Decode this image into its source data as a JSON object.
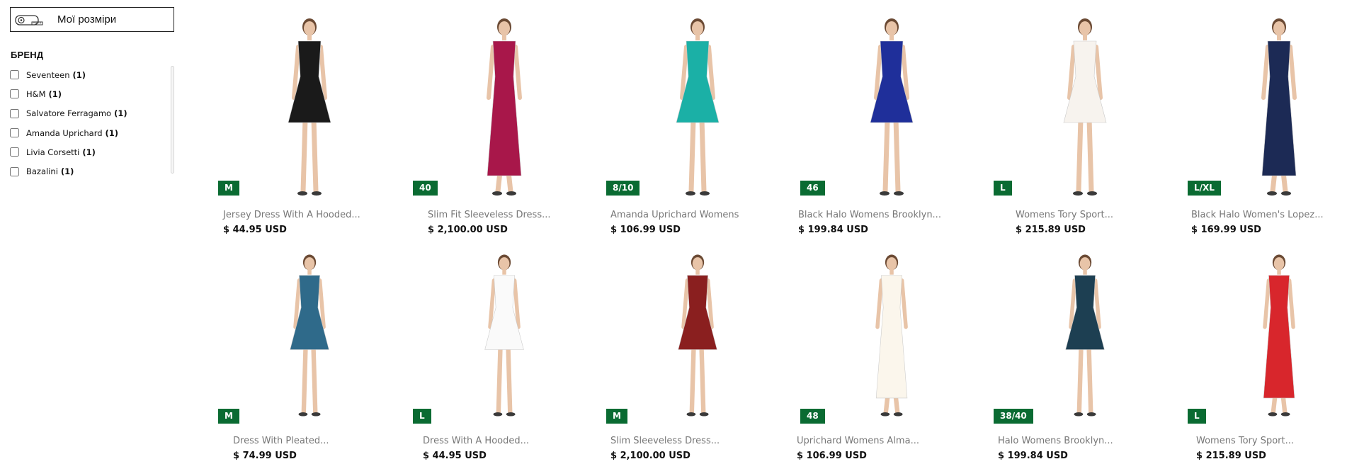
{
  "sidebar": {
    "sizes_button": {
      "label": "Мої розміри",
      "icon": "measuring-tape-icon"
    },
    "brand_title": "БРЕНД",
    "brands": [
      {
        "label": "Seventeen",
        "count": "(1)"
      },
      {
        "label": "H&M",
        "count": "(1)"
      },
      {
        "label": "Salvatore Ferragamo",
        "count": "(1)"
      },
      {
        "label": "Amanda Uprichard",
        "count": "(1)"
      },
      {
        "label": "Livia Corsetti",
        "count": "(1)"
      },
      {
        "label": "Bazalini",
        "count": "(1)"
      }
    ]
  },
  "products": [
    {
      "name": "Jersey Dress With A Hooded...",
      "price": "$ 44.95 USD",
      "size": "M",
      "dress_color": "#1a1a1a"
    },
    {
      "name": "Slim Fit Sleeveless Dress...",
      "price": "$ 2,100.00 USD",
      "size": "40",
      "dress_color": "#a8174a"
    },
    {
      "name": "Amanda Uprichard Womens",
      "price": "$ 106.99 USD",
      "size": "8/10",
      "dress_color": "#1bb0a6"
    },
    {
      "name": "Black Halo Womens Brooklyn...",
      "price": "$ 199.84 USD",
      "size": "46",
      "dress_color": "#1f2f9a"
    },
    {
      "name": "Womens Tory Sport...",
      "price": "$ 215.89 USD",
      "size": "L",
      "dress_color": "#f7f3ee"
    },
    {
      "name": "Black Halo Women's Lopez...",
      "price": "$ 169.99 USD",
      "size": "L/XL",
      "dress_color": "#1c2a55"
    },
    {
      "name": "Dress With Pleated...",
      "price": "$ 74.99 USD",
      "size": "M",
      "dress_color": "#2f6a8a"
    },
    {
      "name": "Dress With A Hooded...",
      "price": "$ 44.95 USD",
      "size": "L",
      "dress_color": "#fafafa"
    },
    {
      "name": "Slim Sleeveless Dress...",
      "price": "$ 2,100.00 USD",
      "size": "M",
      "dress_color": "#8a1f1f"
    },
    {
      "name": "Uprichard Womens Alma...",
      "price": "$ 106.99 USD",
      "size": "48",
      "dress_color": "#fbf6ec"
    },
    {
      "name": "Halo Womens Brooklyn...",
      "price": "$ 199.84 USD",
      "size": "38/40",
      "dress_color": "#1d3f52"
    },
    {
      "name": "Womens Tory Sport...",
      "price": "$ 215.89 USD",
      "size": "L",
      "dress_color": "#d8262c"
    }
  ]
}
